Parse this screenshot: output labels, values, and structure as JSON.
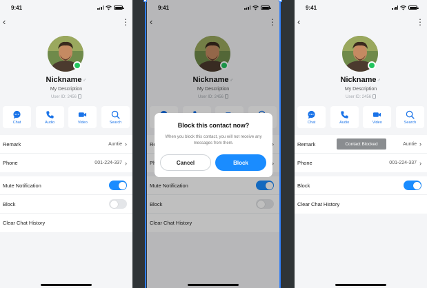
{
  "status_bar": {
    "time": "9:41"
  },
  "profile": {
    "nickname": "Nickname",
    "description": "My Description",
    "user_id": "User ID: 2456",
    "online": true
  },
  "actions": [
    {
      "label": "Chat",
      "icon": "chat-bubble-icon"
    },
    {
      "label": "Audio",
      "icon": "phone-icon"
    },
    {
      "label": "Video",
      "icon": "video-camera-icon"
    },
    {
      "label": "Search",
      "icon": "search-icon"
    }
  ],
  "rows": {
    "remark": {
      "label": "Remark",
      "value": "Auntie"
    },
    "phone": {
      "label": "Phone",
      "value": "001-224-337"
    },
    "mute": {
      "label": "Mute Notification",
      "on": true
    },
    "block": {
      "label": "Block",
      "on": false
    },
    "block_after": {
      "label": "Block",
      "on": true
    },
    "clear": {
      "label": "Clear Chat History"
    }
  },
  "dialog": {
    "title": "Block this contact now?",
    "message": "When you block this contact, you will not receive any messages from them.",
    "cancel_label": "Cancel",
    "confirm_label": "Block"
  },
  "toast": {
    "text": "Contact Blocked"
  },
  "colors": {
    "accent": "#1a8cff",
    "online": "#22c55e",
    "background": "#f4f5f7",
    "canvas": "#2f3437"
  }
}
